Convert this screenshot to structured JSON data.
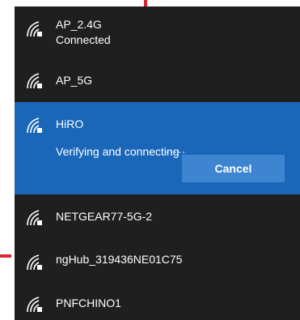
{
  "accent_color": "#d9232f",
  "selected_color": "#1a66b8",
  "button_color": "#3d84d1",
  "networks": [
    {
      "name": "AP_2.4G",
      "status": "Connected",
      "icon": "wifi-secured-icon"
    },
    {
      "name": "AP_5G",
      "icon": "wifi-secured-icon"
    },
    {
      "name": "HiRO",
      "status": "Verifying and connecting",
      "icon": "wifi-secured-icon"
    },
    {
      "name": "NETGEAR77-5G-2",
      "icon": "wifi-secured-icon"
    },
    {
      "name": "ngHub_319436NE01C75",
      "icon": "wifi-secured-icon"
    },
    {
      "name": "PNFCHINO1",
      "icon": "wifi-secured-icon"
    }
  ],
  "selected": {
    "cancel_label": "Cancel"
  }
}
